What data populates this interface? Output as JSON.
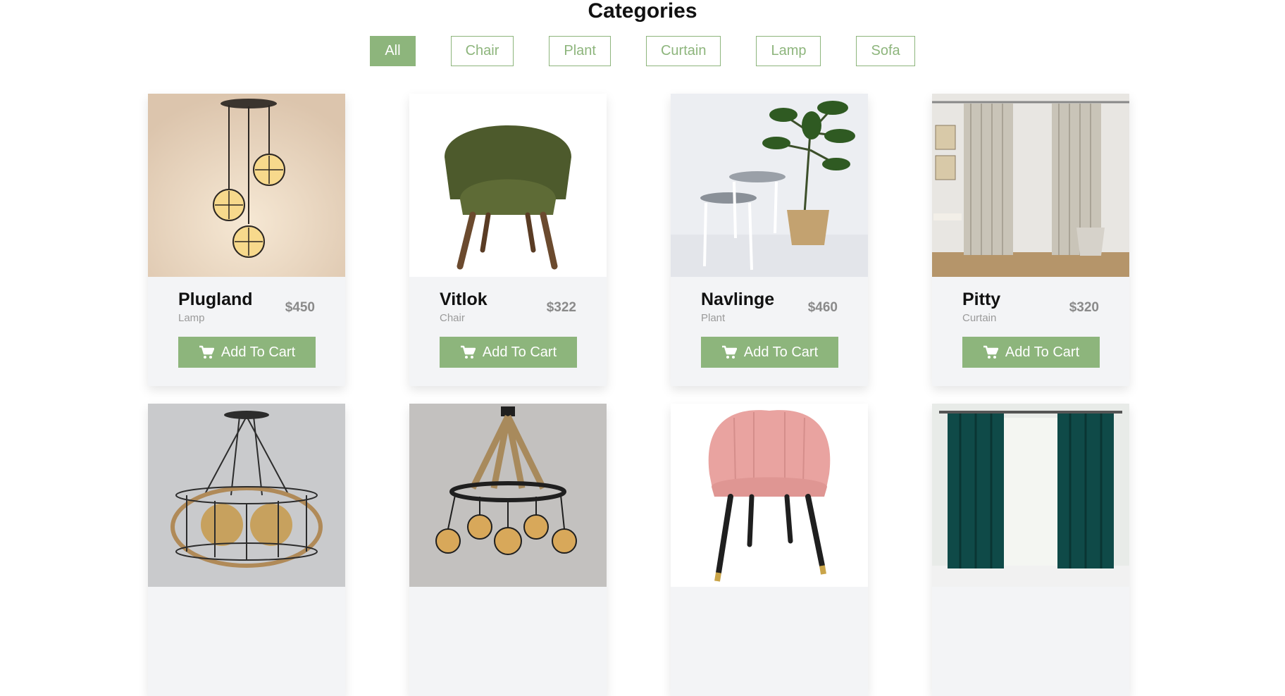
{
  "section": {
    "title": "Categories"
  },
  "filters": [
    {
      "label": "All",
      "active": true
    },
    {
      "label": "Chair",
      "active": false
    },
    {
      "label": "Plant",
      "active": false
    },
    {
      "label": "Curtain",
      "active": false
    },
    {
      "label": "Lamp",
      "active": false
    },
    {
      "label": "Sofa",
      "active": false
    }
  ],
  "products": [
    {
      "name": "Plugland",
      "category": "Lamp",
      "price": "$450",
      "button": "Add To Cart",
      "icon": "cart-icon",
      "image": "pendant-lamp-image"
    },
    {
      "name": "Vitlok",
      "category": "Chair",
      "price": "$322",
      "button": "Add To Cart",
      "icon": "cart-icon",
      "image": "green-chair-image"
    },
    {
      "name": "Navlinge",
      "category": "Plant",
      "price": "$460",
      "button": "Add To Cart",
      "icon": "cart-icon",
      "image": "plant-tables-image"
    },
    {
      "name": "Pitty",
      "category": "Curtain",
      "price": "$320",
      "button": "Add To Cart",
      "icon": "cart-icon",
      "image": "beige-curtain-image"
    },
    {
      "image": "cage-chandelier-image"
    },
    {
      "image": "rope-chandelier-image"
    },
    {
      "image": "pink-chair-image"
    },
    {
      "image": "teal-curtain-image"
    }
  ],
  "colors": {
    "accent": "#8db57c",
    "card_bg": "#f3f4f6",
    "price": "#8a8a8a",
    "category": "#9a9a9a"
  }
}
